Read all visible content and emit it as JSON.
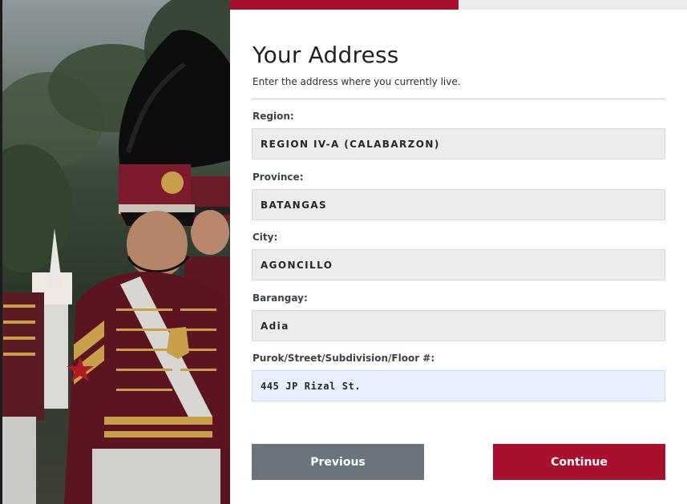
{
  "progress": {
    "fraction": 0.5
  },
  "colors": {
    "accent": "#a8102e",
    "secondary_button": "#6b747c",
    "field_background": "#ececec",
    "active_field_background": "#e8f0fe"
  },
  "form": {
    "title": "Your Address",
    "subtitle": "Enter the address where you currently live.",
    "fields": [
      {
        "label": "Region:",
        "value": "REGION IV-A (CALABARZON)"
      },
      {
        "label": "Province:",
        "value": "BATANGAS"
      },
      {
        "label": "City:",
        "value": "AGONCILLO"
      },
      {
        "label": "Barangay:",
        "value": "Adia"
      },
      {
        "label": "Purok/Street/Subdivision/Floor #:",
        "value": "445 JP Rizal St.",
        "focused": true
      }
    ]
  },
  "buttons": {
    "previous": "Previous",
    "continue": "Continue"
  }
}
